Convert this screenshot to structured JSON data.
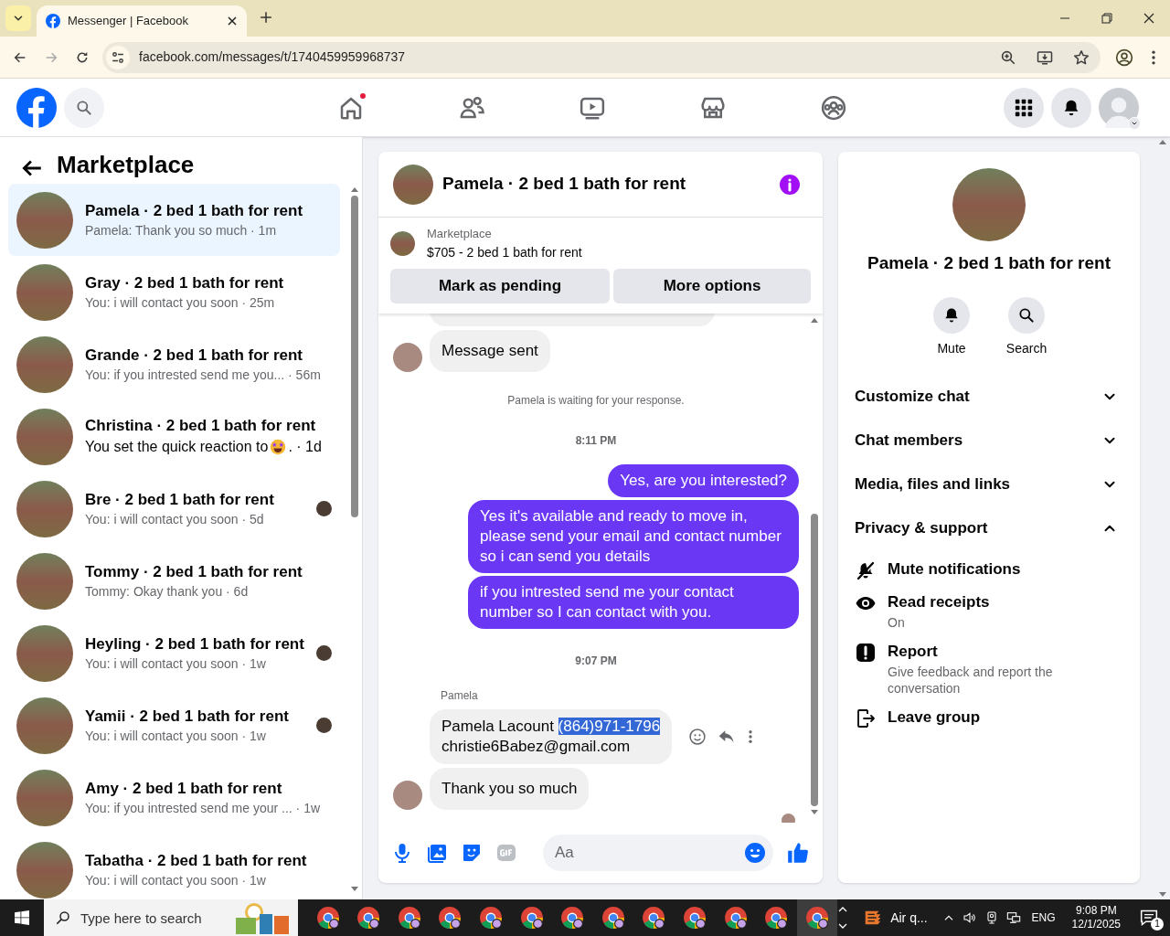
{
  "browser": {
    "tab_title": "Messenger | Facebook",
    "url": "facebook.com/messages/t/1740459959968737"
  },
  "nav": [
    {
      "kind": "home",
      "badge": true
    },
    {
      "kind": "friends",
      "badge": false
    },
    {
      "kind": "video",
      "badge": false
    },
    {
      "kind": "marketplace",
      "badge": false
    },
    {
      "kind": "groups",
      "badge": false
    }
  ],
  "sidebar": {
    "title": "Marketplace",
    "conversations": [
      {
        "title": "Pamela · 2 bed 1 bath for rent",
        "preview": "Pamela: Thank you so much · 1m",
        "selected": true,
        "seen_avatar": false
      },
      {
        "title": "Gray · 2 bed 1 bath for rent",
        "preview": "You: i will contact you soon · 25m",
        "selected": false,
        "seen_avatar": false
      },
      {
        "title": "Grande · 2 bed 1 bath for rent",
        "preview": "You: if you intrested send me you... · 56m",
        "selected": false,
        "seen_avatar": false
      },
      {
        "title": "Christina · 2 bed 1 bath for rent",
        "preview": "You set the quick reaction to",
        "emoji": true,
        "preview_end": ". · 1d",
        "selected": false,
        "seen_avatar": false
      },
      {
        "title": "Bre · 2 bed 1 bath for rent",
        "preview": "You: i will contact you soon · 5d",
        "selected": false,
        "seen_avatar": true
      },
      {
        "title": "Tommy · 2 bed 1 bath for rent",
        "preview": "Tommy: Okay thank you · 6d",
        "selected": false,
        "seen_avatar": false
      },
      {
        "title": "Heyling · 2 bed 1 bath for rent",
        "preview": "You: i will contact you soon · 1w",
        "selected": false,
        "seen_avatar": true
      },
      {
        "title": "Yamii · 2 bed 1 bath for rent",
        "preview": "You: i will contact you soon · 1w",
        "selected": false,
        "seen_avatar": true
      },
      {
        "title": "Amy · 2 bed 1 bath for rent",
        "preview": "You: if you intrested send me your ... · 1w",
        "selected": false,
        "seen_avatar": false
      },
      {
        "title": "Tabatha · 2 bed 1 bath for rent",
        "preview": "You: i will contact you soon · 1w",
        "selected": false,
        "seen_avatar": false
      }
    ]
  },
  "chat": {
    "title": "Pamela · 2 bed 1 bath for rent",
    "listing": {
      "source": "Marketplace",
      "name": "$705 - 2 bed 1 bath for rent"
    },
    "actions": [
      "Mark as pending",
      "More options"
    ],
    "messages": [
      {
        "kind": "cut_off"
      },
      {
        "kind": "incoming",
        "text": "Message sent",
        "avatar": true,
        "actions": false
      },
      {
        "kind": "notice",
        "text": "Pamela is waiting for your response."
      },
      {
        "kind": "time",
        "text": "8:11 PM"
      },
      {
        "kind": "outgoing",
        "text": "Yes, are you interested?"
      },
      {
        "kind": "outgoing",
        "text": "Yes it's available and ready to move in, please send your email and contact number so i can send you details"
      },
      {
        "kind": "outgoing",
        "text": "if you intrested send me your contact number so I can contact with you."
      },
      {
        "kind": "time",
        "text": "9:07 PM"
      },
      {
        "kind": "sender",
        "text": "Pamela"
      },
      {
        "kind": "incoming",
        "lines": [
          [
            {
              "text": "Pamela Lacount ",
              "highlighted": false
            },
            {
              "text": "(864)971-1796",
              "highlighted": true
            }
          ],
          [
            {
              "text": "christie6Babez@gmail.com",
              "highlighted": false
            }
          ]
        ],
        "avatar": false,
        "actions": true
      },
      {
        "kind": "incoming",
        "text": "Thank you so much",
        "avatar": true,
        "actions": false
      },
      {
        "kind": "seen"
      }
    ],
    "composer": {
      "placeholder": "Aa"
    }
  },
  "details": {
    "title": "Pamela · 2 bed 1 bath for rent",
    "buttons": [
      {
        "kind": "mute",
        "label": "Mute"
      },
      {
        "kind": "search",
        "label": "Search"
      }
    ],
    "sections": [
      {
        "label": "Customize chat",
        "expanded": false
      },
      {
        "label": "Chat members",
        "expanded": false
      },
      {
        "label": "Media, files and links",
        "expanded": false
      },
      {
        "label": "Privacy & support",
        "expanded": true
      }
    ],
    "options": [
      {
        "kind": "mute",
        "label": "Mute notifications"
      },
      {
        "kind": "eye",
        "label": "Read receipts",
        "subtitle": "On"
      },
      {
        "kind": "report",
        "label": "Report",
        "subtitle": "Give feedback and report the conversation"
      },
      {
        "kind": "leave",
        "label": "Leave group"
      }
    ]
  },
  "taskbar": {
    "search_placeholder": "Type here to search",
    "apps": [
      {
        "selected": false
      },
      {
        "selected": false
      },
      {
        "selected": false
      },
      {
        "selected": false
      },
      {
        "selected": false
      },
      {
        "selected": false
      },
      {
        "selected": false
      },
      {
        "selected": false
      },
      {
        "selected": false
      },
      {
        "selected": false
      },
      {
        "selected": false
      },
      {
        "selected": false
      },
      {
        "selected": true
      }
    ],
    "weather": "Air q...",
    "language": "ENG",
    "time": "9:08 PM",
    "date": "12/1/2025",
    "notifications": "1"
  }
}
